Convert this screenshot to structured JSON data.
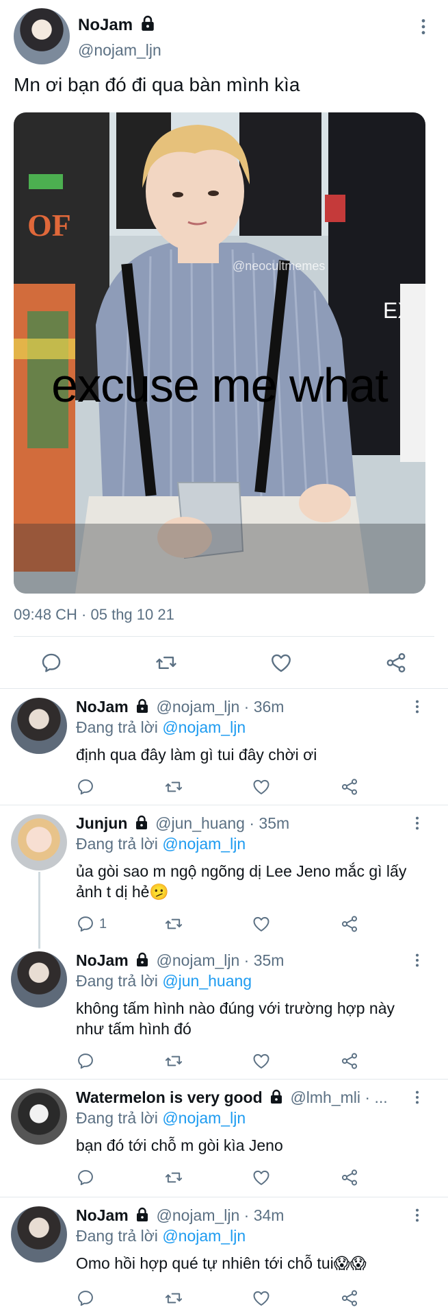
{
  "main_tweet": {
    "name": "NoJam",
    "handle": "@nojam_ljn",
    "text": "Mn ơi bạn đó đi qua bàn mình kìa",
    "image_caption": "excuse me what",
    "watermark": "@neocultmemes",
    "timestamp": "09:48 CH · 05 thg 10 21"
  },
  "icons": {
    "lock": "lock-icon",
    "more": "more-vertical-icon",
    "reply": "reply-icon",
    "retweet": "retweet-icon",
    "like": "heart-icon",
    "share": "share-icon"
  },
  "colors": {
    "link": "#1d9bf0",
    "secondary_text": "#5b7083",
    "divider": "#e3e8ec"
  },
  "replies": [
    {
      "name": "NoJam",
      "handle": "@nojam_ljn",
      "time": "· 36m",
      "replying_prefix": "Đang trả lời",
      "replying_to": "@nojam_ljn",
      "text": "định qua đây làm gì tui đây chời ơi",
      "reply_count": ""
    },
    {
      "name": "Junjun",
      "handle": "@jun_huang",
      "time": "· 35m",
      "replying_prefix": "Đang trả lời",
      "replying_to": "@nojam_ljn",
      "text": "ủa gòi sao m ngộ ngõng dị Lee Jeno mắc gì lấy ảnh t dị hẻ🫤",
      "reply_count": "1"
    },
    {
      "name": "NoJam",
      "handle": "@nojam_ljn",
      "time": "· 35m",
      "replying_prefix": "Đang trả lời",
      "replying_to": "@jun_huang",
      "text": "không tấm hình nào đúng với trường hợp này như tấm hình đó",
      "reply_count": ""
    },
    {
      "name": "Watermelon is very good",
      "handle": "@lmh_mli",
      "time": "· ...",
      "replying_prefix": "Đang trả lời",
      "replying_to": "@nojam_ljn",
      "text": "bạn đó tới chỗ m gòi kìa Jeno",
      "reply_count": ""
    },
    {
      "name": "NoJam",
      "handle": "@nojam_ljn",
      "time": "· 34m",
      "replying_prefix": "Đang trả lời",
      "replying_to": "@nojam_ljn",
      "text": "Omo hồi hợp qué tự nhiên tới chỗ tui😱😱",
      "reply_count": ""
    }
  ]
}
